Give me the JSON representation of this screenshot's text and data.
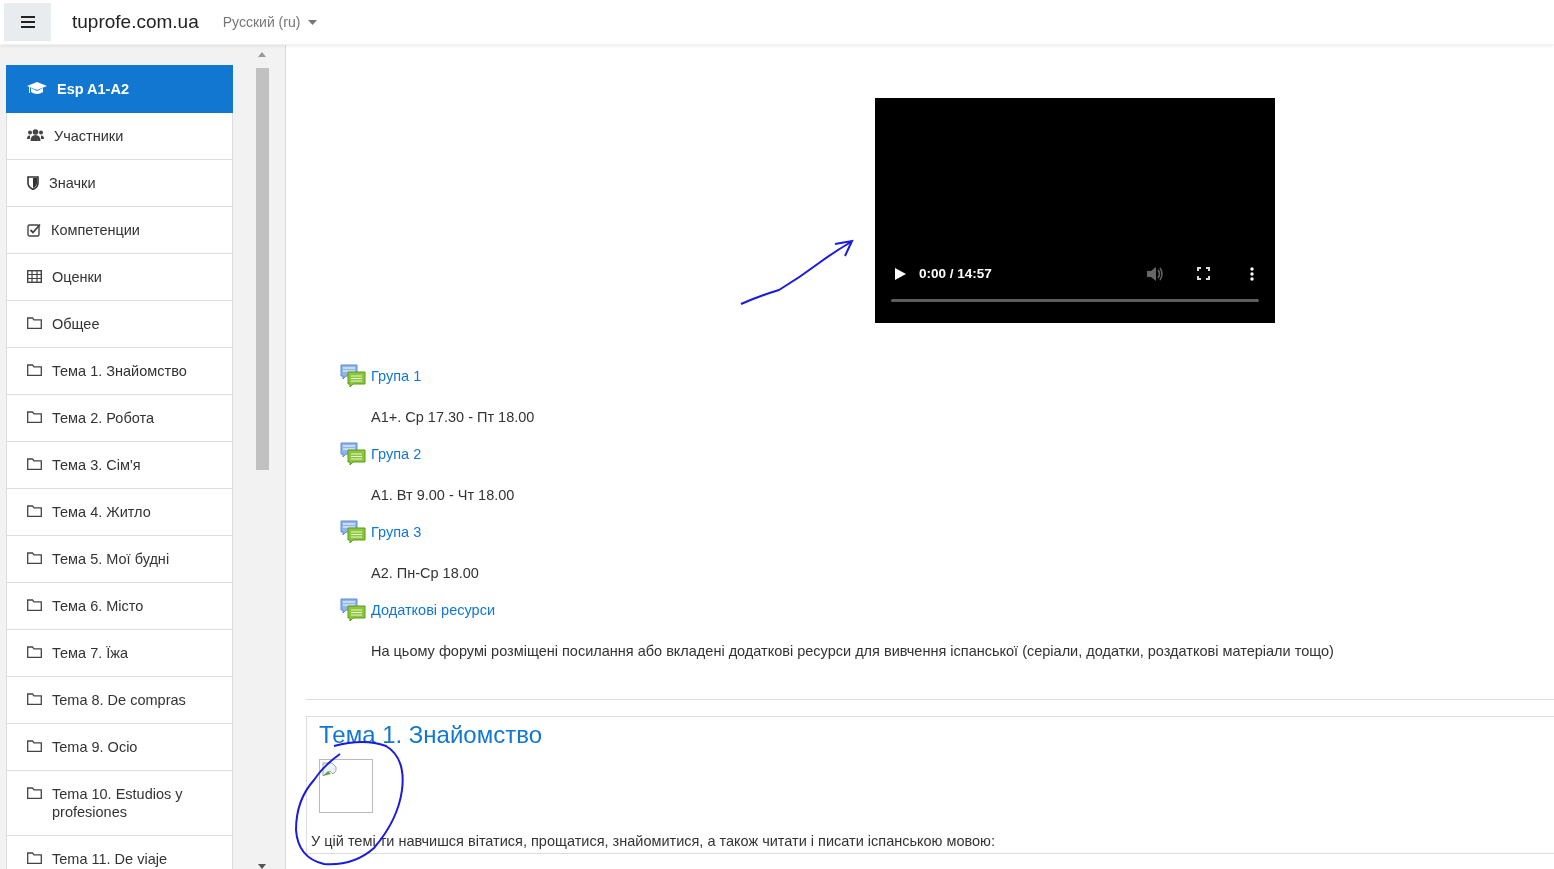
{
  "navbar": {
    "site_name": "tuprofe.com.ua",
    "language": "Русский (ru)"
  },
  "sidebar": {
    "items": [
      {
        "label": "Esp A1-A2",
        "kind": "course",
        "selected": true
      },
      {
        "label": "Участники",
        "kind": "users",
        "selected": false
      },
      {
        "label": "Значки",
        "kind": "shield",
        "selected": false
      },
      {
        "label": "Компетенции",
        "kind": "check",
        "selected": false
      },
      {
        "label": "Оценки",
        "kind": "table",
        "selected": false
      },
      {
        "label": "Общее",
        "kind": "folder",
        "selected": false
      },
      {
        "label": "Тема 1. Знайомство",
        "kind": "folder",
        "selected": false
      },
      {
        "label": "Тема 2. Робота",
        "kind": "folder",
        "selected": false
      },
      {
        "label": "Тема 3. Сім'я",
        "kind": "folder",
        "selected": false
      },
      {
        "label": "Тема 4. Житло",
        "kind": "folder",
        "selected": false
      },
      {
        "label": "Тема 5. Мої будні",
        "kind": "folder",
        "selected": false
      },
      {
        "label": "Тема 6. Місто",
        "kind": "folder",
        "selected": false
      },
      {
        "label": "Тема 7. Їжа",
        "kind": "folder",
        "selected": false
      },
      {
        "label": "Tema 8. De compras",
        "kind": "folder",
        "selected": false
      },
      {
        "label": "Tema 9. Ocio",
        "kind": "folder",
        "selected": false
      },
      {
        "label": "Tema 10. Estudios y profesiones",
        "kind": "folder",
        "selected": false
      },
      {
        "label": "Tema 11. De viaje",
        "kind": "folder",
        "selected": false
      }
    ]
  },
  "video": {
    "time": "0:00 / 14:57"
  },
  "activities": [
    {
      "title": "Група 1",
      "description": "A1+. Ср 17.30 - Пт 18.00"
    },
    {
      "title": "Група 2",
      "description": "A1. Вт 9.00 - Чт 18.00"
    },
    {
      "title": "Група 3",
      "description": "A2. Пн-Ср 18.00"
    },
    {
      "title": "Додаткові ресурси",
      "description": "На цьому форумі розміщені посилання або вкладені додаткові ресурси для вивчення іспанської (серіали, додатки, роздаткові матеріали тощо)"
    }
  ],
  "section": {
    "title": "Тема 1. Знайомство",
    "summary": "У цій темі ти навчишся вітатися, прощатися, знайомитися, а також читати і писати іспанською мовою:"
  }
}
